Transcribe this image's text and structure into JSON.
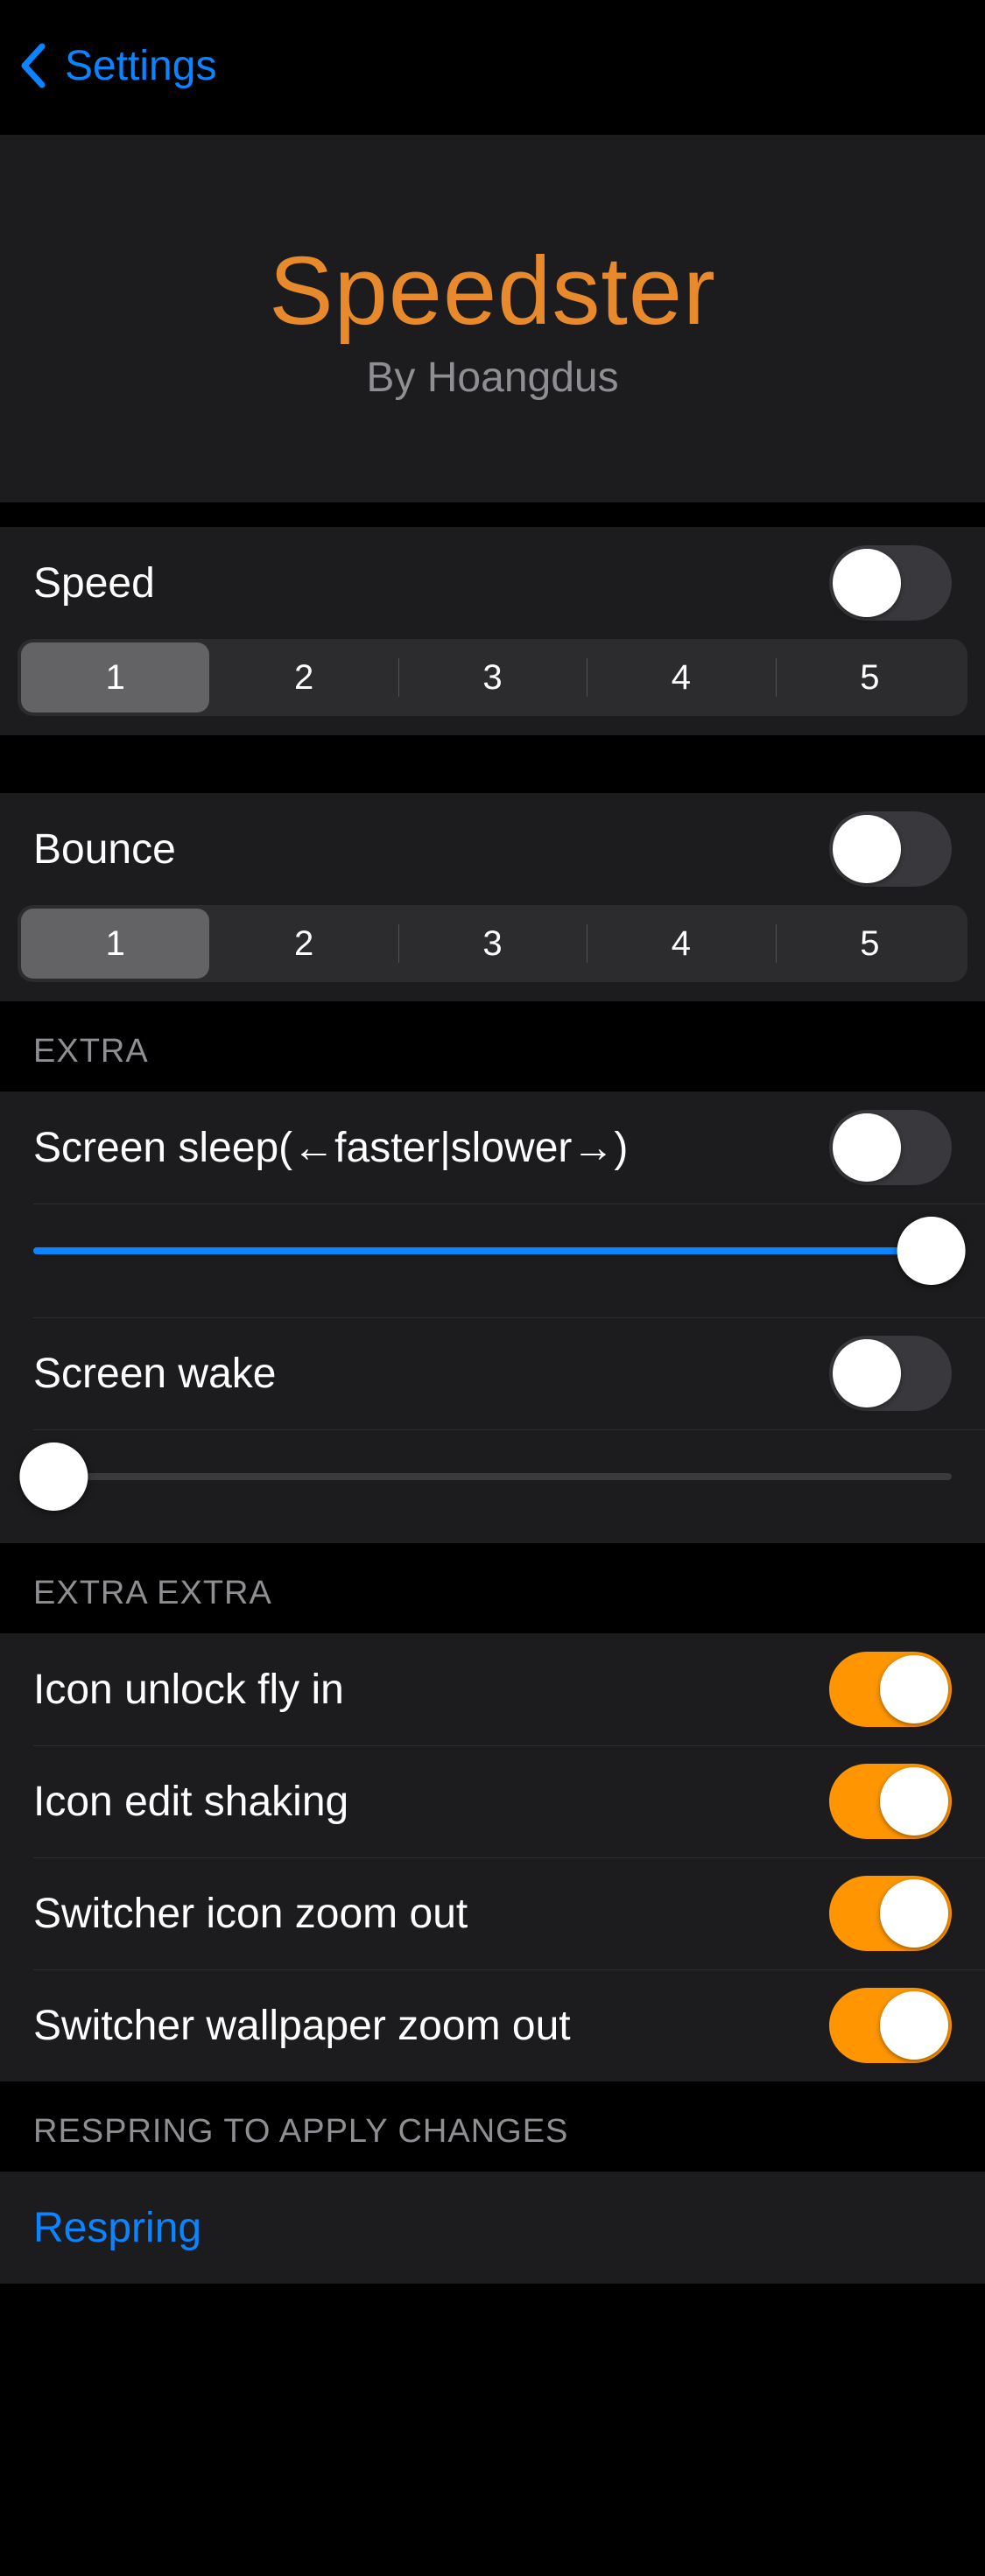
{
  "nav": {
    "back_label": "Settings"
  },
  "header": {
    "title": "Speedster",
    "author": "By Hoangdus"
  },
  "speed_section": {
    "label": "Speed",
    "toggle_on": false,
    "segments": [
      "1",
      "2",
      "3",
      "4",
      "5"
    ],
    "selected_index": 0
  },
  "bounce_section": {
    "label": "Bounce",
    "toggle_on": false,
    "segments": [
      "1",
      "2",
      "3",
      "4",
      "5"
    ],
    "selected_index": 0
  },
  "extra": {
    "header": "EXTRA",
    "screen_sleep": {
      "label": "Screen sleep(←faster|slower→)",
      "toggle_on": false,
      "slider_percent": 100
    },
    "screen_wake": {
      "label": "Screen wake",
      "toggle_on": false,
      "slider_percent": 0
    }
  },
  "extra_extra": {
    "header": "EXTRA EXTRA",
    "items": [
      {
        "label": "Icon unlock fly in",
        "on": true
      },
      {
        "label": "Icon edit shaking",
        "on": true
      },
      {
        "label": "Switcher icon zoom out",
        "on": true
      },
      {
        "label": "Switcher wallpaper zoom out",
        "on": true
      }
    ]
  },
  "respring": {
    "header": "RESPRING TO APPLY CHANGES",
    "action": "Respring"
  }
}
